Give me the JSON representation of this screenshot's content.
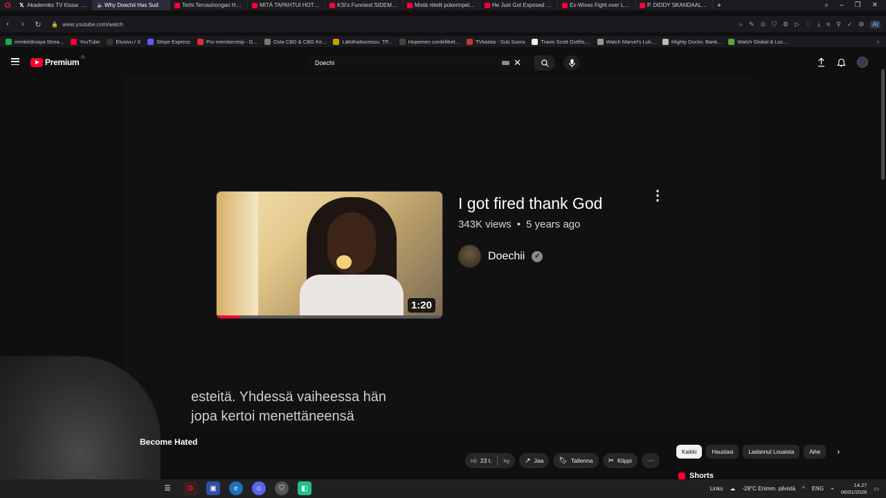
{
  "browser": {
    "tabs": [
      {
        "title": "Akademiks TV Kissa: \"Adin",
        "icon": "x-icon",
        "active": false
      },
      {
        "title": "Why Doechii Has Sud",
        "icon": "speaker-icon",
        "active": true
      },
      {
        "title": "Terhi Tervashongan Haast",
        "icon": "youtube-icon",
        "active": false
      },
      {
        "title": "MITÄ TAPAHTUI HOTELLI",
        "icon": "youtube-icon",
        "active": false
      },
      {
        "title": "KSI's Funniest SIDEMEN M",
        "icon": "youtube-icon",
        "active": false
      },
      {
        "title": "Mistä riitelit pokerinpelaa",
        "icon": "youtube-icon",
        "active": false
      },
      {
        "title": "He Just Got Exposed - You",
        "icon": "youtube-icon",
        "active": false
      },
      {
        "title": "Ex-Wives Fight over Late",
        "icon": "youtube-icon",
        "active": false
      },
      {
        "title": "P. DIDDY SKANDAALI - Pe",
        "icon": "youtube-icon",
        "active": false
      }
    ],
    "url": "www.youtube.com/watch",
    "bookmarks": [
      {
        "label": "mmikedmaya Strea...",
        "color": "#22aa44"
      },
      {
        "label": "YouTube",
        "color": "#ff0033"
      },
      {
        "label": "Etusivu / X",
        "color": "#333333"
      },
      {
        "label": "Stripe Express",
        "color": "#635bff"
      },
      {
        "label": "Pro membership - G...",
        "color": "#e03030"
      },
      {
        "label": "Osta CBD & CBG Ke...",
        "color": "#777777"
      },
      {
        "label": "Lättähattureissu: TP...",
        "color": "#c8a000"
      },
      {
        "label": "Hopeinen cordelliket...",
        "color": "#444444"
      },
      {
        "label": "TVkaista - Sub Suora",
        "color": "#cc3333"
      },
      {
        "label": "Travis Scott Outfits,...",
        "color": "#eeeeee"
      },
      {
        "label": "Watch Marvel's Luk...",
        "color": "#999999"
      },
      {
        "label": "Mighty Ducks: Bank...",
        "color": "#bbbbbb"
      },
      {
        "label": "Watch Global & Loc...",
        "color": "#55aa33"
      }
    ]
  },
  "youtube": {
    "logo_text": "Premium",
    "logo_superscript": "FI",
    "search_value": "Doechi"
  },
  "end_card": {
    "duration": "1:20",
    "progress": 0.1,
    "title": "I got fired thank God",
    "views": "343K views",
    "separator": "•",
    "age": "5 years ago",
    "channel": "Doechii"
  },
  "subtitle": {
    "line1": "esteitä.  Yhdessä vaiheessa hän",
    "line2": "jopa kertoi menettäneensä"
  },
  "video_title_partial": "Become Hated",
  "actions": {
    "like_count": "23 t.",
    "share": "Jaa",
    "save": "Tallenna",
    "clip": "Klippi"
  },
  "chips": [
    "Kaikki",
    "Haustasi",
    "Ladannut Louaista",
    "Aihe"
  ],
  "shorts_label": "Shorts",
  "taskbar": {
    "links": "Links",
    "weather": "-28°C  Enimm. pilvistä",
    "lang": "ENG",
    "time": "14.27",
    "date": "06/01/2026"
  },
  "colors": {
    "brand_red": "#ff0033",
    "background": "#0f0f0f"
  }
}
